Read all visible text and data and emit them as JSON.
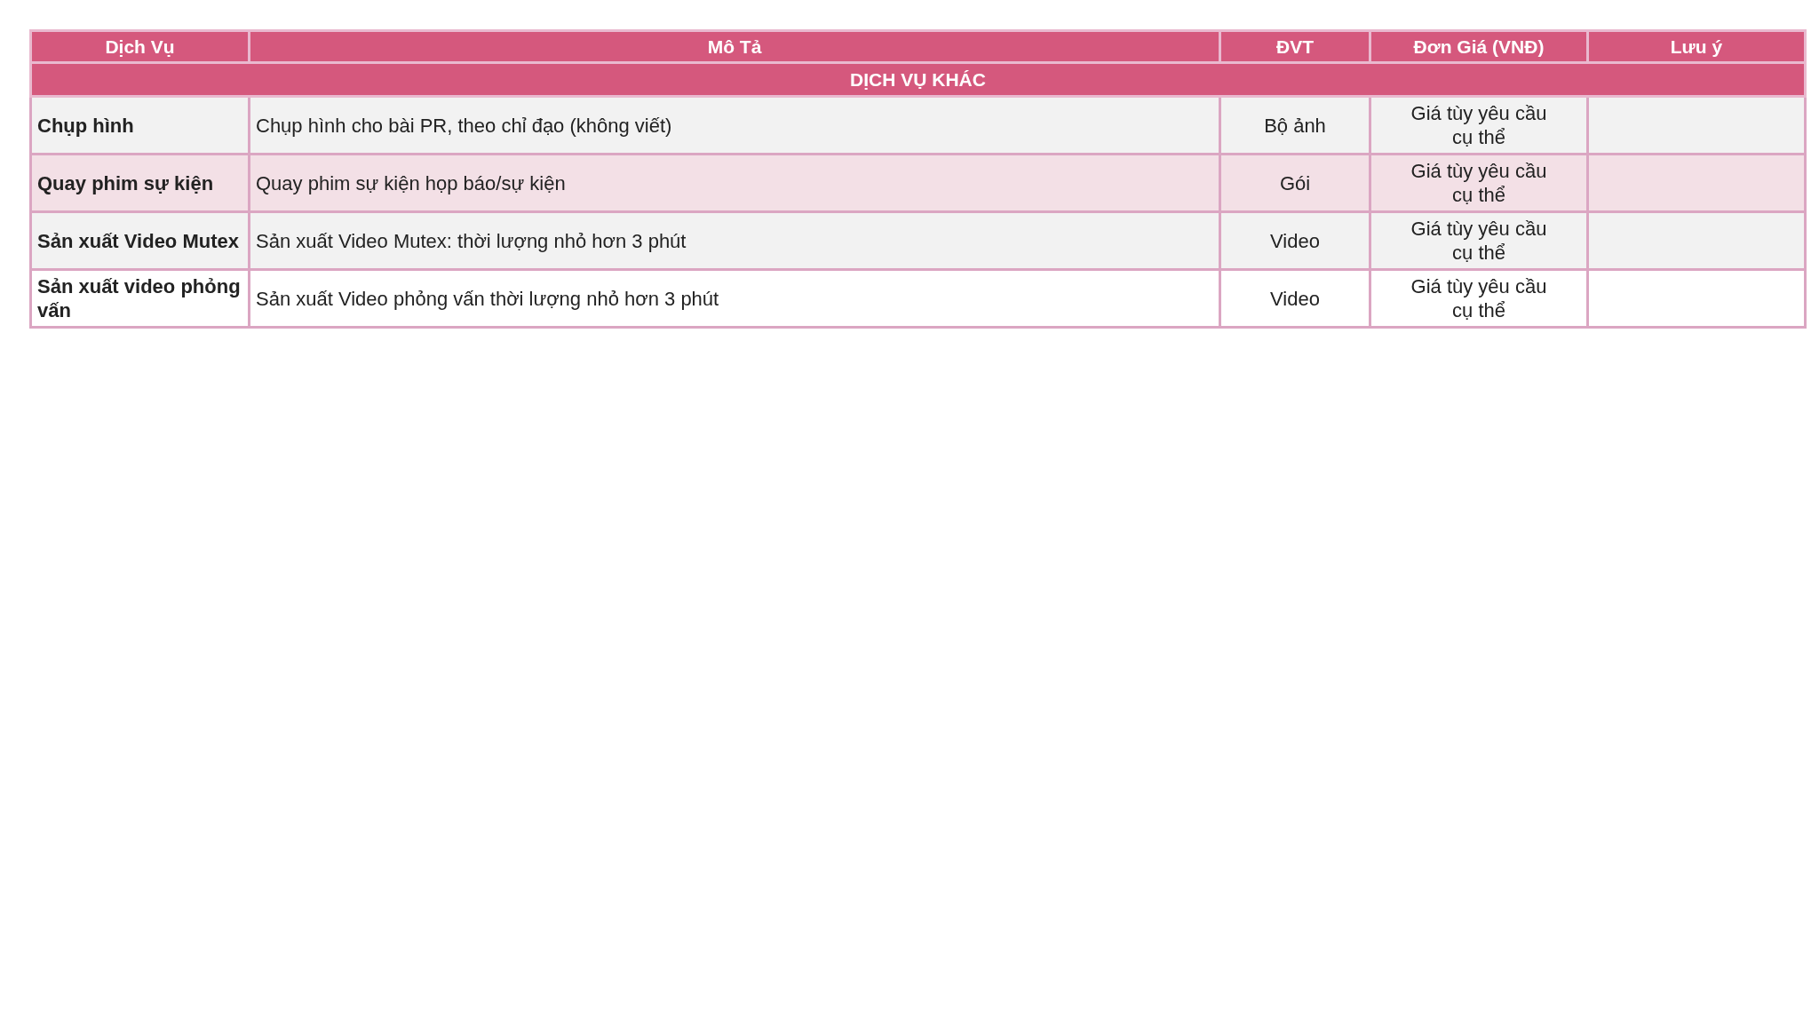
{
  "table": {
    "columns": [
      "Dịch Vụ",
      "Mô Tả",
      "ĐVT",
      "Đơn Giá (VNĐ)",
      "Lưu ý"
    ],
    "section": "DỊCH VỤ KHÁC",
    "rows": [
      {
        "service": "Chụp hình",
        "description": "Chụp hình cho bài PR, theo chỉ đạo (không viết)",
        "unit": "Bộ ảnh",
        "price": "Giá tùy yêu cầu cụ thể"
      },
      {
        "service": "Quay phim sự kiện",
        "description": "Quay phim sự kiện họp báo/sự kiện",
        "unit": "Gói",
        "price": "Giá tùy yêu cầu cụ thể"
      },
      {
        "service": "Sản xuất Video Mutex",
        "description": "Sản xuất Video Mutex: thời lượng nhỏ hơn 3 phút",
        "unit": "Video",
        "price": "Giá tùy yêu cầu cụ thể"
      },
      {
        "service": "Sản xuất video phỏng vấn",
        "description": "Sản xuất Video phỏng vấn thời lượng nhỏ hơn 3 phút",
        "unit": "Video",
        "price": "Giá tùy yêu cầu cụ thể"
      }
    ]
  }
}
